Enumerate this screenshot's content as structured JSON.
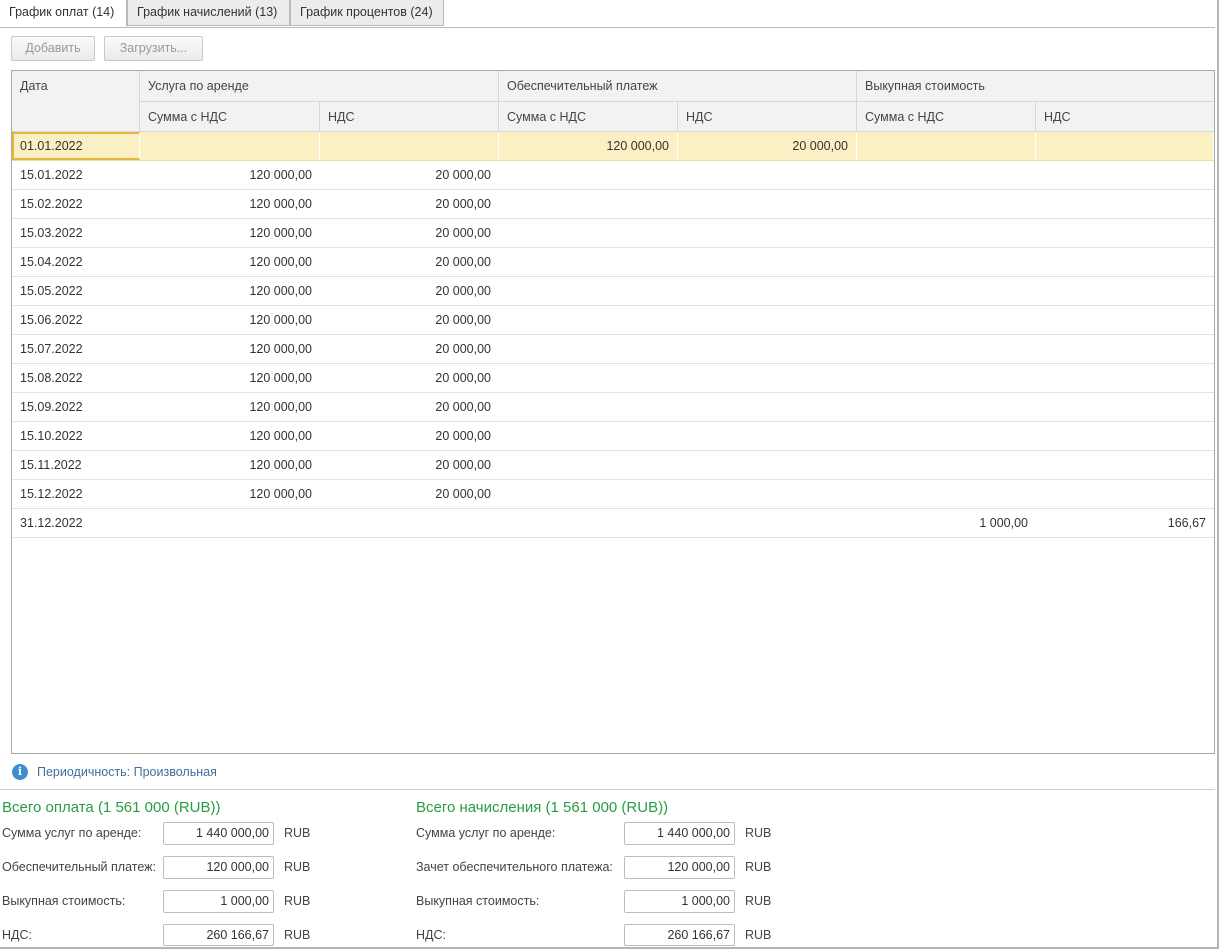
{
  "tabs": [
    {
      "label": "График оплат (14)",
      "active": true
    },
    {
      "label": "График начислений (13)",
      "active": false
    },
    {
      "label": "График процентов (24)",
      "active": false
    }
  ],
  "toolbar": {
    "add_label": "Добавить",
    "load_label": "Загрузить..."
  },
  "grid": {
    "headers": {
      "date": "Дата",
      "rent": "Услуга по аренде",
      "deposit": "Обеспечительный платеж",
      "buyout": "Выкупная стоимость",
      "sum_vat": "Сумма с НДС",
      "vat": "НДС"
    },
    "rows": [
      {
        "date": "01.01.2022",
        "rent_sum": "",
        "rent_vat": "",
        "dep_sum": "120 000,00",
        "dep_vat": "20 000,00",
        "buy_sum": "",
        "buy_vat": "",
        "selected": true
      },
      {
        "date": "15.01.2022",
        "rent_sum": "120 000,00",
        "rent_vat": "20 000,00",
        "dep_sum": "",
        "dep_vat": "",
        "buy_sum": "",
        "buy_vat": ""
      },
      {
        "date": "15.02.2022",
        "rent_sum": "120 000,00",
        "rent_vat": "20 000,00",
        "dep_sum": "",
        "dep_vat": "",
        "buy_sum": "",
        "buy_vat": ""
      },
      {
        "date": "15.03.2022",
        "rent_sum": "120 000,00",
        "rent_vat": "20 000,00",
        "dep_sum": "",
        "dep_vat": "",
        "buy_sum": "",
        "buy_vat": ""
      },
      {
        "date": "15.04.2022",
        "rent_sum": "120 000,00",
        "rent_vat": "20 000,00",
        "dep_sum": "",
        "dep_vat": "",
        "buy_sum": "",
        "buy_vat": ""
      },
      {
        "date": "15.05.2022",
        "rent_sum": "120 000,00",
        "rent_vat": "20 000,00",
        "dep_sum": "",
        "dep_vat": "",
        "buy_sum": "",
        "buy_vat": ""
      },
      {
        "date": "15.06.2022",
        "rent_sum": "120 000,00",
        "rent_vat": "20 000,00",
        "dep_sum": "",
        "dep_vat": "",
        "buy_sum": "",
        "buy_vat": ""
      },
      {
        "date": "15.07.2022",
        "rent_sum": "120 000,00",
        "rent_vat": "20 000,00",
        "dep_sum": "",
        "dep_vat": "",
        "buy_sum": "",
        "buy_vat": ""
      },
      {
        "date": "15.08.2022",
        "rent_sum": "120 000,00",
        "rent_vat": "20 000,00",
        "dep_sum": "",
        "dep_vat": "",
        "buy_sum": "",
        "buy_vat": ""
      },
      {
        "date": "15.09.2022",
        "rent_sum": "120 000,00",
        "rent_vat": "20 000,00",
        "dep_sum": "",
        "dep_vat": "",
        "buy_sum": "",
        "buy_vat": ""
      },
      {
        "date": "15.10.2022",
        "rent_sum": "120 000,00",
        "rent_vat": "20 000,00",
        "dep_sum": "",
        "dep_vat": "",
        "buy_sum": "",
        "buy_vat": ""
      },
      {
        "date": "15.11.2022",
        "rent_sum": "120 000,00",
        "rent_vat": "20 000,00",
        "dep_sum": "",
        "dep_vat": "",
        "buy_sum": "",
        "buy_vat": ""
      },
      {
        "date": "15.12.2022",
        "rent_sum": "120 000,00",
        "rent_vat": "20 000,00",
        "dep_sum": "",
        "dep_vat": "",
        "buy_sum": "",
        "buy_vat": ""
      },
      {
        "date": "31.12.2022",
        "rent_sum": "",
        "rent_vat": "",
        "dep_sum": "",
        "dep_vat": "",
        "buy_sum": "1 000,00",
        "buy_vat": "166,67"
      }
    ]
  },
  "info": {
    "icon": "info-icon",
    "text": "Периодичность: Произвольная"
  },
  "totals": {
    "payments": {
      "title": "Всего оплата (1 561 000 (RUB))",
      "fields": [
        {
          "label": "Сумма услуг по аренде:",
          "value": "1 440 000,00",
          "currency": "RUB"
        },
        {
          "label": "Обеспечительный платеж:",
          "value": "120 000,00",
          "currency": "RUB"
        },
        {
          "label": "Выкупная стоимость:",
          "value": "1 000,00",
          "currency": "RUB"
        },
        {
          "label": "НДС:",
          "value": "260 166,67",
          "currency": "RUB"
        }
      ]
    },
    "accruals": {
      "title": "Всего начисления (1 561 000 (RUB))",
      "fields": [
        {
          "label": "Сумма услуг по аренде:",
          "value": "1 440 000,00",
          "currency": "RUB"
        },
        {
          "label": "Зачет обеспечительного платежа:",
          "value": "120 000,00",
          "currency": "RUB"
        },
        {
          "label": "Выкупная стоимость:",
          "value": "1 000,00",
          "currency": "RUB"
        },
        {
          "label": "НДС:",
          "value": "260 166,67",
          "currency": "RUB"
        }
      ]
    }
  },
  "colors": {
    "accent_green": "#2a9c45",
    "selection": "#fbf0c4",
    "info_blue": "#3d8fd1"
  }
}
